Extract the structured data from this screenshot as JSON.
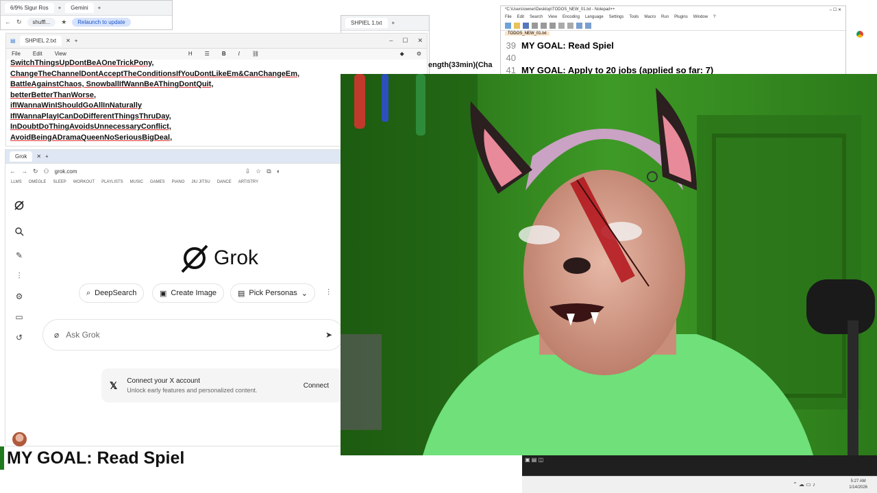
{
  "top_left_browser": {
    "tab1_label": "6/9% Sigur Ros",
    "tab2_label": "Gemini",
    "url": "shuffl...",
    "relaunch_label": "Relaunch to update"
  },
  "notepad_small": {
    "tab_label": "SHPIEL 2.txt",
    "menu": [
      "File",
      "Edit",
      "View"
    ],
    "toolbar_heading": "H",
    "lines": [
      "SwitchThingsUpDontBeAOneTrickPony,",
      "ChangeTheChannelDontAcceptTheConditionsIfYouDontLikeEm&CanChangeEm,",
      "BattleAgainstChaos, SnowballIfWannBeAThingDontQuit,",
      "betterBetterThanWorse,",
      "ifIWannaWinIShouldGoAllInNaturally",
      "IfIWannaPlayICanDoDifferentThingsThruDay,",
      "InDoubtDoThingAvoidsUnnecessaryConflict,",
      "AvoidBeingADramaQueenNoSeriousBigDeal,"
    ]
  },
  "mid_window": {
    "tab_label": "SHPIEL 1.txt",
    "overflow_text": "ength(33min)(Cha"
  },
  "grok_browser": {
    "tab_label": "Grok",
    "url": "grok.com",
    "bookmarks": [
      "LLMS",
      "OMEGLE",
      "SLEEP",
      "WORKOUT",
      "PLAYLISTS",
      "MUSIC",
      "GAMES",
      "PIANO",
      "JIU JITSU",
      "DANCE",
      "ARTISTRY"
    ],
    "logo_text": "Grok",
    "chips": [
      "DeepSearch",
      "Create Image",
      "Pick Personas"
    ],
    "ask_placeholder": "Ask Grok",
    "connect_title": "Connect your X account",
    "connect_subtitle": "Unlock early features and personalized content.",
    "connect_button": "Connect"
  },
  "notepadpp": {
    "title": "*C:\\Users\\owner\\Desktop\\TODOS_NEW_01.txt - Notepad++",
    "menu": [
      "File",
      "Edit",
      "Search",
      "View",
      "Encoding",
      "Language",
      "Settings",
      "Tools",
      "Macro",
      "Run",
      "Plugins",
      "Window",
      "?"
    ],
    "tab_label": "TODOS_NEW_01.txt",
    "lines": [
      {
        "num": "39",
        "text": "MY GOAL: Read Spiel",
        "bold": true
      },
      {
        "num": "40",
        "text": "",
        "bold": false
      },
      {
        "num": "41",
        "text": "MY GOAL:  Apply to 20 jobs   (applied so far: 7)",
        "bold": true
      }
    ]
  },
  "bottom_goal": "MY GOAL: Read Spiel",
  "taskbar": {
    "time": "5:27 AM",
    "date": "1/14/2026"
  },
  "colors": {
    "webcam_bg": "#2f7a1f",
    "shirt": "#5ddc6a",
    "wall": "#3b8c22"
  }
}
